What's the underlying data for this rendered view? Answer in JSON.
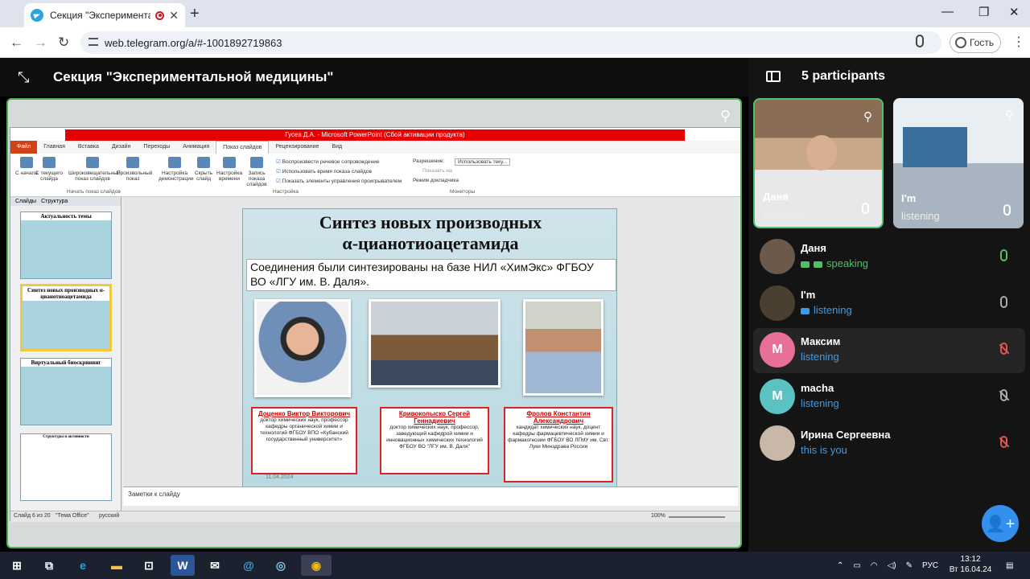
{
  "browser": {
    "tab_title": "Секция \"Экспериментальн",
    "url": "web.telegram.org/a/#-1001892719863",
    "guest_label": "Гость"
  },
  "call": {
    "title": "Секция \"Экспериментальной медицины\"",
    "participants_count_label": "5 participants"
  },
  "ppt": {
    "window_title": "Гусев Д.А. - Microsoft PowerPoint (Сбой активации продукта)",
    "tabs": [
      "Файл",
      "Главная",
      "Вставка",
      "Дизайн",
      "Переходы",
      "Анимация",
      "Показ слайдов",
      "Рецензирование",
      "Вид"
    ],
    "ribbon": {
      "b1": "С начала",
      "b2": "С текущего слайда",
      "b3": "Широковещательный показ слайдов",
      "b4": "Произвольный показ",
      "b5": "Настройка демонстрации",
      "b6": "Скрыть слайд",
      "b7": "Настройка времени",
      "b8": "Запись показа слайдов",
      "c1": "Воспроизвести речевое сопровождение",
      "c2": "Использовать время показа слайдов",
      "c3": "Показать элементы управления проигрывателем",
      "res_label": "Разрешение:",
      "res_value": "Использовать теку...",
      "show_on": "Показать на:",
      "presenter": "Режим докладчика",
      "g1": "Начать показ слайдов",
      "g2": "Настройка",
      "g3": "Мониторы"
    },
    "side_tabs": [
      "Слайды",
      "Структура"
    ],
    "thumbs": [
      "Актуальность темы",
      "Синтез новых производных α-цианотиоацетамида",
      "Виртуальный биоскрининг",
      "Структуры и активности"
    ],
    "slide": {
      "title_line1": "Синтез новых производных",
      "title_line2": "α-цианотиоацетамида",
      "subtitle": "Соединения были синтезированы на базе НИЛ «ХимЭкс» ФГБОУ ВО «ЛГУ им. В. Даля».",
      "date": "11.04.2024",
      "people": [
        {
          "name": "Доценко Виктор Викторович",
          "desc": "доктор химических наук, профессор кафедры органической химии и технологий ФГБОУ ВПО «Кубанский государственный университет»"
        },
        {
          "name": "Кривоколыско Сергей Геннадиевич",
          "desc": "доктор химических наук, профессор, заведующий кафедрой химии и инновационных химических технологий ФГБОУ ВО \"ЛГУ им. В. Даля\""
        },
        {
          "name": "Фролов Константин Александрович",
          "desc": "кандидат химических наук, доцент кафедры фармацевтической химии и фармакогнозии ФГБОУ ВО ЛГМУ им. Свт. Луки Минздрава России"
        }
      ]
    },
    "notes_placeholder": "Заметки к слайду",
    "status": {
      "slide": "Слайд 6 из 20",
      "theme": "\"Тема Office\"",
      "lang": "русский",
      "zoom": "100%"
    }
  },
  "video_tiles": [
    {
      "name": "Даня",
      "status": "speaking"
    },
    {
      "name": "I'm",
      "status": "listening"
    }
  ],
  "participants": [
    {
      "name": "Даня",
      "status": "speaking",
      "initial": "",
      "color": "#6b5a4c"
    },
    {
      "name": "I'm",
      "status": "listening",
      "initial": "",
      "color": "#4a4030"
    },
    {
      "name": "Максим",
      "status": "listening",
      "initial": "М",
      "color": "#e86f9a"
    },
    {
      "name": "macha",
      "status": "listening",
      "initial": "M",
      "color": "#5bc2c2"
    },
    {
      "name": "Ирина Сергеевна",
      "status": "this is you",
      "initial": "",
      "color": "#c9b8a8"
    }
  ],
  "taskbar": {
    "lang": "РУС",
    "time": "13:12",
    "date": "Вт 16.04.24"
  },
  "colors": {
    "accent": "#3390ec",
    "speaking": "#4ec26a",
    "muted": "#e55252",
    "screen_border": "#4fae4e"
  }
}
